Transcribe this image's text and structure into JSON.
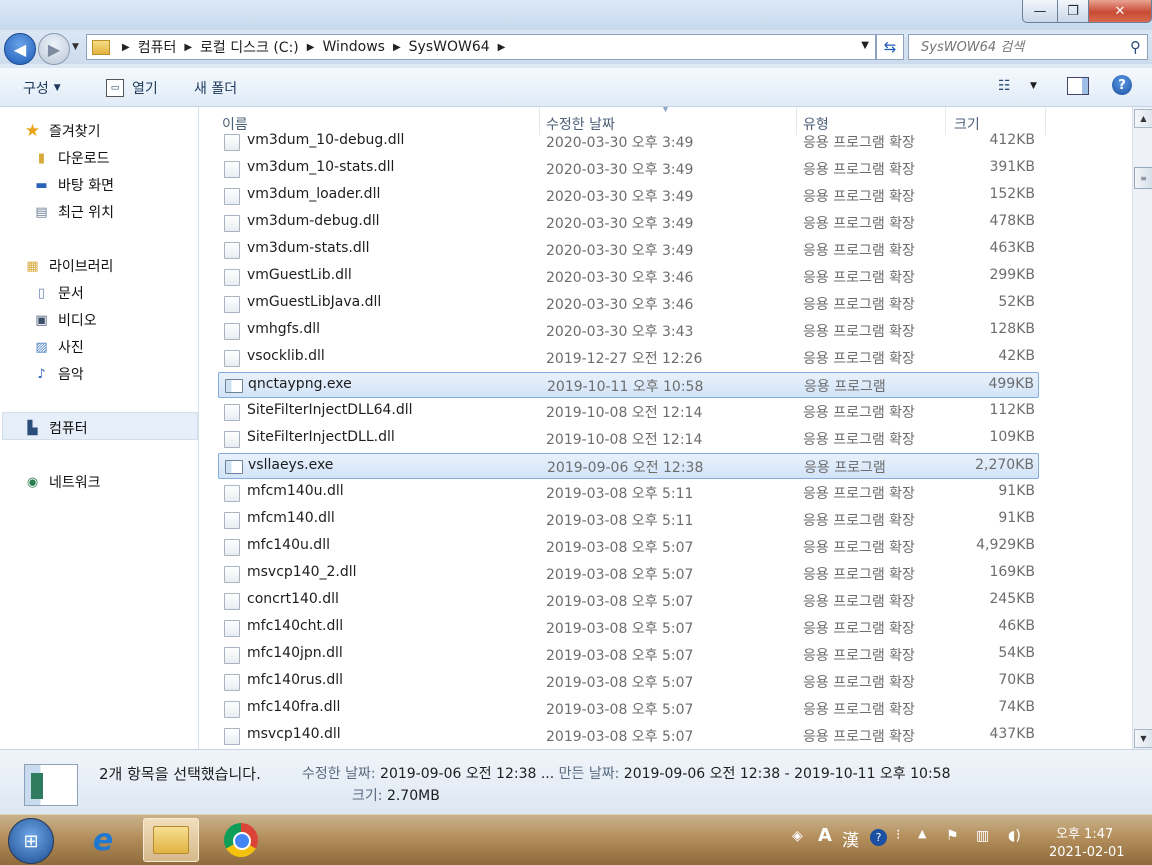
{
  "window": {
    "minimize_glyph": "—",
    "maximize_glyph": "❐",
    "close_glyph": "✕"
  },
  "address": {
    "segments": [
      "컴퓨터",
      "로컬 디스크 (C:)",
      "Windows",
      "SysWOW64"
    ],
    "search_placeholder": "SysWOW64 검색"
  },
  "toolbar": {
    "organize": "구성",
    "open": "열기",
    "new_folder": "새 폴더"
  },
  "nav_pane": {
    "favorites": "즐겨찾기",
    "downloads": "다운로드",
    "desktop": "바탕 화면",
    "recent": "최근 위치",
    "libraries": "라이브러리",
    "documents": "문서",
    "videos": "비디오",
    "pictures": "사진",
    "music": "음악",
    "computer": "컴퓨터",
    "network": "네트워크"
  },
  "columns": {
    "name": "이름",
    "date": "수정한 날짜",
    "type": "유형",
    "size": "크기"
  },
  "files": [
    {
      "name": "vm3dum_10-debug.dll",
      "date": "2020-03-30 오후 3:49",
      "type": "응용 프로그램 확장",
      "size": "412KB",
      "selected": false,
      "kind": "dll"
    },
    {
      "name": "vm3dum_10-stats.dll",
      "date": "2020-03-30 오후 3:49",
      "type": "응용 프로그램 확장",
      "size": "391KB",
      "selected": false,
      "kind": "dll"
    },
    {
      "name": "vm3dum_loader.dll",
      "date": "2020-03-30 오후 3:49",
      "type": "응용 프로그램 확장",
      "size": "152KB",
      "selected": false,
      "kind": "dll"
    },
    {
      "name": "vm3dum-debug.dll",
      "date": "2020-03-30 오후 3:49",
      "type": "응용 프로그램 확장",
      "size": "478KB",
      "selected": false,
      "kind": "dll"
    },
    {
      "name": "vm3dum-stats.dll",
      "date": "2020-03-30 오후 3:49",
      "type": "응용 프로그램 확장",
      "size": "463KB",
      "selected": false,
      "kind": "dll"
    },
    {
      "name": "vmGuestLib.dll",
      "date": "2020-03-30 오후 3:46",
      "type": "응용 프로그램 확장",
      "size": "299KB",
      "selected": false,
      "kind": "dll"
    },
    {
      "name": "vmGuestLibJava.dll",
      "date": "2020-03-30 오후 3:46",
      "type": "응용 프로그램 확장",
      "size": "52KB",
      "selected": false,
      "kind": "dll"
    },
    {
      "name": "vmhgfs.dll",
      "date": "2020-03-30 오후 3:43",
      "type": "응용 프로그램 확장",
      "size": "128KB",
      "selected": false,
      "kind": "dll"
    },
    {
      "name": "vsocklib.dll",
      "date": "2019-12-27 오전 12:26",
      "type": "응용 프로그램 확장",
      "size": "42KB",
      "selected": false,
      "kind": "dll"
    },
    {
      "name": "qnctaypng.exe",
      "date": "2019-10-11 오후 10:58",
      "type": "응용 프로그램",
      "size": "499KB",
      "selected": true,
      "kind": "exe"
    },
    {
      "name": "SiteFilterInjectDLL64.dll",
      "date": "2019-10-08 오전 12:14",
      "type": "응용 프로그램 확장",
      "size": "112KB",
      "selected": false,
      "kind": "dll"
    },
    {
      "name": "SiteFilterInjectDLL.dll",
      "date": "2019-10-08 오전 12:14",
      "type": "응용 프로그램 확장",
      "size": "109KB",
      "selected": false,
      "kind": "dll"
    },
    {
      "name": "vsllaeys.exe",
      "date": "2019-09-06 오전 12:38",
      "type": "응용 프로그램",
      "size": "2,270KB",
      "selected": true,
      "kind": "exe"
    },
    {
      "name": "mfcm140u.dll",
      "date": "2019-03-08 오후 5:11",
      "type": "응용 프로그램 확장",
      "size": "91KB",
      "selected": false,
      "kind": "dll"
    },
    {
      "name": "mfcm140.dll",
      "date": "2019-03-08 오후 5:11",
      "type": "응용 프로그램 확장",
      "size": "91KB",
      "selected": false,
      "kind": "dll"
    },
    {
      "name": "mfc140u.dll",
      "date": "2019-03-08 오후 5:07",
      "type": "응용 프로그램 확장",
      "size": "4,929KB",
      "selected": false,
      "kind": "dll"
    },
    {
      "name": "msvcp140_2.dll",
      "date": "2019-03-08 오후 5:07",
      "type": "응용 프로그램 확장",
      "size": "169KB",
      "selected": false,
      "kind": "dll"
    },
    {
      "name": "concrt140.dll",
      "date": "2019-03-08 오후 5:07",
      "type": "응용 프로그램 확장",
      "size": "245KB",
      "selected": false,
      "kind": "dll"
    },
    {
      "name": "mfc140cht.dll",
      "date": "2019-03-08 오후 5:07",
      "type": "응용 프로그램 확장",
      "size": "46KB",
      "selected": false,
      "kind": "dll"
    },
    {
      "name": "mfc140jpn.dll",
      "date": "2019-03-08 오후 5:07",
      "type": "응용 프로그램 확장",
      "size": "54KB",
      "selected": false,
      "kind": "dll"
    },
    {
      "name": "mfc140rus.dll",
      "date": "2019-03-08 오후 5:07",
      "type": "응용 프로그램 확장",
      "size": "70KB",
      "selected": false,
      "kind": "dll"
    },
    {
      "name": "mfc140fra.dll",
      "date": "2019-03-08 오후 5:07",
      "type": "응용 프로그램 확장",
      "size": "74KB",
      "selected": false,
      "kind": "dll"
    },
    {
      "name": "msvcp140.dll",
      "date": "2019-03-08 오후 5:07",
      "type": "응용 프로그램 확장",
      "size": "437KB",
      "selected": false,
      "kind": "dll"
    }
  ],
  "details": {
    "title": "2개 항목을 선택했습니다.",
    "modified_label": "수정한 날짜:",
    "modified_value": "2019-09-06 오전 12:38 ...",
    "created_label": "만든 날짜:",
    "created_value": "2019-09-06 오전 12:38 - 2019-10-11 오후 10:58",
    "size_label": "크기:",
    "size_value": "2.70MB"
  },
  "taskbar": {
    "ime_a": "A",
    "ime_han": "漢",
    "clock_time": "오후 1:47",
    "clock_date": "2021-02-01"
  },
  "colors": {
    "selection_border": "#84acdd",
    "accent": "#1d5bb8"
  }
}
